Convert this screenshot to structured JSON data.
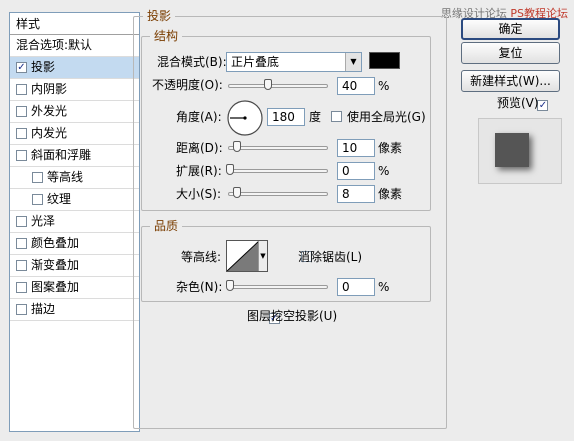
{
  "styles_panel": {
    "title": "样式",
    "blend_options": "混合选项:默认",
    "items": [
      {
        "label": "投影",
        "checked": true,
        "selected": true,
        "indent": false
      },
      {
        "label": "内阴影",
        "checked": false,
        "selected": false,
        "indent": false
      },
      {
        "label": "外发光",
        "checked": false,
        "selected": false,
        "indent": false
      },
      {
        "label": "内发光",
        "checked": false,
        "selected": false,
        "indent": false
      },
      {
        "label": "斜面和浮雕",
        "checked": false,
        "selected": false,
        "indent": false
      },
      {
        "label": "等高线",
        "checked": false,
        "selected": false,
        "indent": true
      },
      {
        "label": "纹理",
        "checked": false,
        "selected": false,
        "indent": true
      },
      {
        "label": "光泽",
        "checked": false,
        "selected": false,
        "indent": false
      },
      {
        "label": "颜色叠加",
        "checked": false,
        "selected": false,
        "indent": false
      },
      {
        "label": "渐变叠加",
        "checked": false,
        "selected": false,
        "indent": false
      },
      {
        "label": "图案叠加",
        "checked": false,
        "selected": false,
        "indent": false
      },
      {
        "label": "描边",
        "checked": false,
        "selected": false,
        "indent": false
      }
    ]
  },
  "drop_shadow": {
    "section_title": "投影",
    "structure": {
      "title": "结构",
      "blend_mode_label": "混合模式(B):",
      "blend_mode_value": "正片叠底",
      "shadow_color": "#000000",
      "opacity_label": "不透明度(O):",
      "opacity_value": "40",
      "opacity_unit": "%",
      "angle_label": "角度(A):",
      "angle_value": "180",
      "angle_unit": "度",
      "global_light_label": "使用全局光(G)",
      "global_light_checked": false,
      "distance_label": "距离(D):",
      "distance_value": "10",
      "distance_unit": "像素",
      "spread_label": "扩展(R):",
      "spread_value": "0",
      "spread_unit": "%",
      "size_label": "大小(S):",
      "size_value": "8",
      "size_unit": "像素"
    },
    "quality": {
      "title": "品质",
      "contour_label": "等高线:",
      "anti_alias_label": "消除锯齿(L)",
      "anti_alias_checked": false,
      "noise_label": "杂色(N):",
      "noise_value": "0",
      "noise_unit": "%"
    },
    "knockout_label": "图层挖空投影(U)",
    "knockout_checked": true
  },
  "buttons": {
    "ok": "确定",
    "reset": "复位",
    "new_style": "新建样式(W)...",
    "preview_label": "预览(V)",
    "preview_checked": true
  },
  "watermark": {
    "text": "思缘设计论坛",
    "site": "PS教程论坛"
  }
}
